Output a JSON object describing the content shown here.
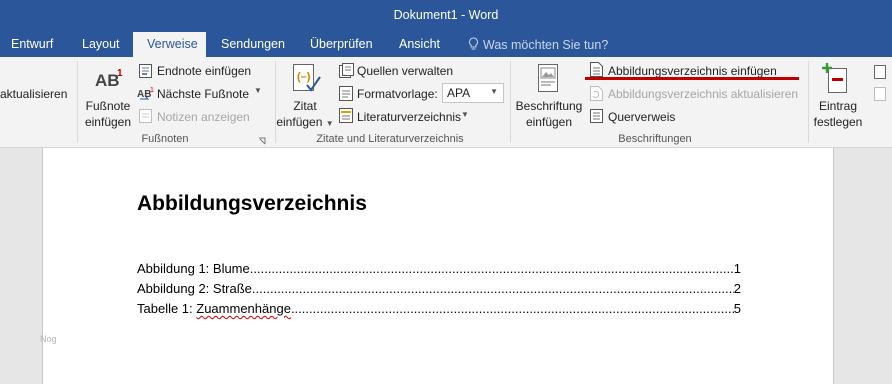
{
  "window": {
    "title": "Dokument1 - Word"
  },
  "tabs": {
    "entwurf": "Entwurf",
    "layout": "Layout",
    "verweise": "Verweise",
    "sendungen": "Sendungen",
    "ueberpruefen": "Überprüfen",
    "ansicht": "Ansicht",
    "tell_me": "Was möchten Sie tun?"
  },
  "ribbon": {
    "aktualisieren": "aktualisieren",
    "footnotes": {
      "insert_line1": "Fußnote",
      "insert_line2": "einfügen",
      "endnote": "Endnote einfügen",
      "next": "Nächste Fußnote",
      "show": "Notizen anzeigen",
      "group_label": "Fußnoten"
    },
    "citations": {
      "insert_line1": "Zitat",
      "insert_line2": "einfügen",
      "manage": "Quellen verwalten",
      "style_label": "Formatvorlage:",
      "style_value": "APA",
      "bibliography": "Literaturverzeichnis",
      "group_label": "Zitate und Literaturverzeichnis"
    },
    "captions": {
      "insert_line1": "Beschriftung",
      "insert_line2": "einfügen",
      "insert_tof": "Abbildungsverzeichnis einfügen",
      "update_tof": "Abbildungsverzeichnis aktualisieren",
      "crossref": "Querverweis",
      "group_label": "Beschriftungen"
    },
    "index": {
      "mark_line1": "Eintrag",
      "mark_line2": "festlegen"
    }
  },
  "document": {
    "heading": "Abbildungsverzeichnis",
    "entries": [
      {
        "label": "Abbildung 1: Blume",
        "page": "1"
      },
      {
        "label": "Abbildung 2: Straße",
        "page": "2"
      },
      {
        "label_prefix": "Tabelle 1: ",
        "label_word": "Zuammenhänge",
        "page": "5"
      }
    ],
    "margin_mark": "Nog"
  },
  "colors": {
    "word_blue": "#2b579a",
    "ribbon_bg": "#f3f3f3",
    "highlight_red": "#c00000"
  }
}
